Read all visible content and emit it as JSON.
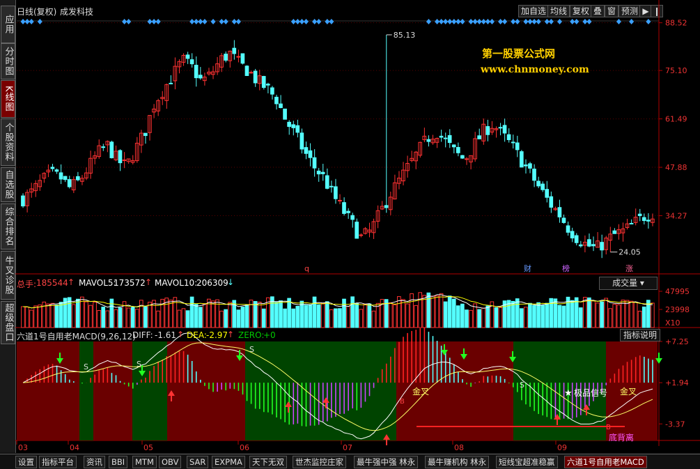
{
  "sidebar": {
    "items": [
      {
        "label": "应用",
        "active": false
      },
      {
        "label": "分时图",
        "active": false
      },
      {
        "label": "K线图",
        "active": true
      },
      {
        "label": "个股资料",
        "active": false
      },
      {
        "label": "自选股",
        "active": false
      },
      {
        "label": "综合排名",
        "active": false
      },
      {
        "label": "牛叉诊股",
        "active": false
      },
      {
        "label": "超级盘口",
        "active": false
      }
    ]
  },
  "header": {
    "period": "日线(复权)",
    "stock_name": "成发科技",
    "buttons": [
      "加自选",
      "均线",
      "复权",
      "叠",
      "窗",
      "预测"
    ]
  },
  "watermark": {
    "line1": "第一股票公式网",
    "line2": "www.chnmoney.com"
  },
  "price_panel": {
    "axis_labels": [
      "88.52",
      "75.10",
      "61.49",
      "47.88",
      "34.27"
    ],
    "high_label": "85.13",
    "low_label": "24.05",
    "event_markers": [
      "q",
      "财",
      "榜",
      "涨"
    ]
  },
  "volume_panel": {
    "legend_label": "总手:",
    "legend_value": "185544",
    "mavol5_label": "MAVOL5:",
    "mavol5_value": "173572",
    "mavol10_label": "MAVOL10:",
    "mavol10_value": "206309",
    "dropdown": "成交量",
    "axis_labels": [
      "47995",
      "23998",
      "X10"
    ]
  },
  "macd_panel": {
    "title": "六道1号自用老MACD(9,26,12)",
    "diff_label": "DIFF:",
    "diff_value": "-1.61",
    "dea_label": "DEA:",
    "dea_value": "-2.97",
    "zero_label": "ZERO:",
    "zero_value": "+0",
    "help_button": "指标说明",
    "axis_labels": [
      "+7.25",
      "+1.94",
      "-3.37"
    ],
    "annotations": {
      "golden_cross_1": "金叉",
      "golden_cross_2": "金叉",
      "star_text": "极品信号",
      "bottom_divergence": "底背离",
      "s_marker": "S",
      "b_marker": "B"
    }
  },
  "x_axis": {
    "labels": [
      "03",
      "04",
      "05",
      "06",
      "07",
      "08",
      "09"
    ]
  },
  "bottom_tabs": [
    {
      "label": "设置",
      "active": false
    },
    {
      "label": "指标平台",
      "active": false
    },
    {
      "label": "资讯",
      "active": false
    },
    {
      "label": "BBI",
      "active": false
    },
    {
      "label": "MTM",
      "active": false
    },
    {
      "label": "OBV",
      "active": false
    },
    {
      "label": "SAR",
      "active": false
    },
    {
      "label": "EXPMA",
      "active": false
    },
    {
      "label": "天下无双",
      "active": false
    },
    {
      "label": "世杰监控庄家",
      "active": false
    },
    {
      "label": "最牛强中强 林永",
      "active": false
    },
    {
      "label": "最牛赚机构 林永",
      "active": false
    },
    {
      "label": "短线宝超准稳赢",
      "active": false
    },
    {
      "label": "六道1号自用老MACD",
      "active": true
    }
  ],
  "colors": {
    "up": "#ff3232",
    "down": "#54ffff",
    "bg_up_zone": "#6a0000",
    "bg_down_zone": "#004400",
    "axis": "#b00000"
  },
  "chart_data": [
    {
      "type": "candlestick",
      "title": "成发科技",
      "ylim": [
        18.5,
        91
      ],
      "y_ticks": [
        88.52,
        75.1,
        61.49,
        47.88,
        34.27
      ],
      "x_ticks": [
        "03",
        "04",
        "05",
        "06",
        "07",
        "08",
        "09"
      ],
      "annotations": {
        "high": 85.13,
        "low": 24.05
      },
      "close_path": [
        39,
        41,
        44,
        46,
        45,
        42,
        44,
        48,
        52,
        54,
        50,
        48,
        53,
        58,
        66,
        70,
        74,
        78,
        76,
        72,
        74,
        78,
        80,
        77,
        75,
        72,
        70,
        67,
        61,
        57,
        52,
        48,
        45,
        40,
        36,
        32,
        28,
        30,
        35,
        40,
        44,
        48,
        52,
        56,
        58,
        55,
        52,
        50,
        54,
        58,
        60,
        57,
        54,
        50,
        46,
        42,
        38,
        35,
        31,
        28,
        26,
        25,
        27,
        29,
        30,
        32,
        34,
        35
      ]
    },
    {
      "type": "bar",
      "title": "成交量",
      "series": [
        {
          "name": "总手",
          "last": 185544
        },
        {
          "name": "MAVOL5",
          "last": 173572
        },
        {
          "name": "MAVOL10",
          "last": 206309
        }
      ],
      "ylim": [
        0,
        47995
      ],
      "y_ticks": [
        47995,
        23998
      ]
    },
    {
      "type": "line",
      "title": "六道1号自用老MACD(9,26,12)",
      "series": [
        {
          "name": "DIFF",
          "last": -1.61
        },
        {
          "name": "DEA",
          "last": -2.97
        },
        {
          "name": "ZERO",
          "last": 0
        }
      ],
      "ylim": [
        -5.5,
        7.25
      ],
      "y_ticks": [
        7.25,
        1.94,
        -3.37
      ]
    }
  ]
}
